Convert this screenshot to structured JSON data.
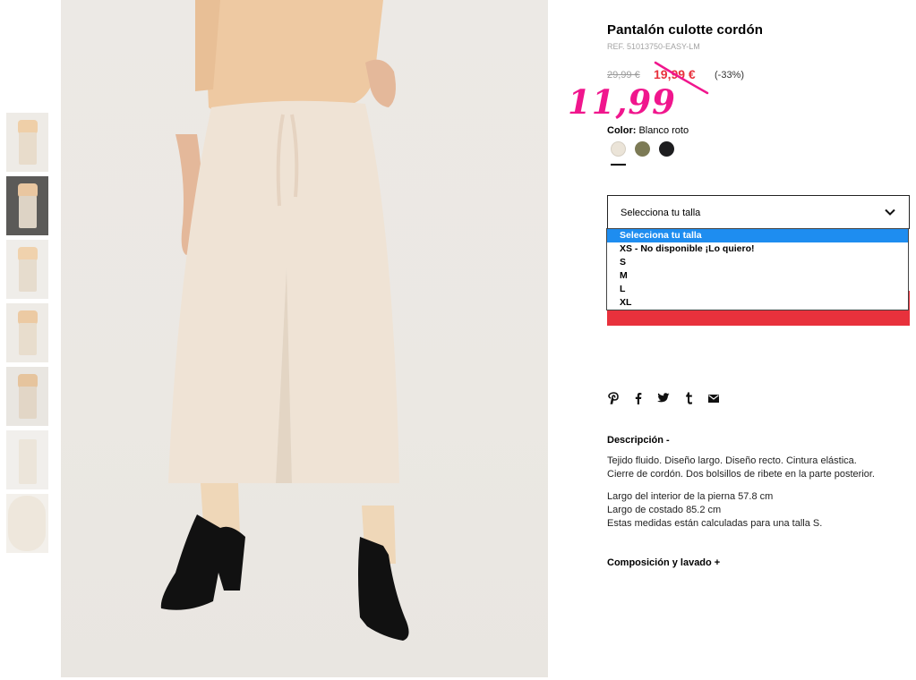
{
  "product": {
    "title": "Pantalón culotte cordón",
    "ref": "REF. 51013750-EASY-LM",
    "old_price": "29,99 €",
    "sale_price": "19,99 €",
    "discount": "(-33%)",
    "handwritten_price": "11,99"
  },
  "color": {
    "label": "Color:",
    "value": " Blanco roto",
    "swatches": [
      {
        "name": "Blanco roto",
        "hex": "#ebe4d8"
      },
      {
        "name": "Caqui",
        "hex": "#7c7a55"
      },
      {
        "name": "Negro",
        "hex": "#1d1d1f"
      }
    ]
  },
  "size": {
    "select_label": "Selecciona tu talla",
    "options": [
      "Selecciona tu talla",
      "XS - No disponible ¡Lo quiero!",
      "S",
      "M",
      "L",
      "XL"
    ]
  },
  "share_icons": [
    "pinterest-icon",
    "facebook-icon",
    "twitter-icon",
    "tumblr-icon",
    "email-icon"
  ],
  "description": {
    "title": "Descripción -",
    "p1_line1": "Tejido fluido. Diseño largo. Diseño recto. Cintura elástica.",
    "p1_line2": "Cierre de cordón. Dos bolsillos de ribete en la parte posterior.",
    "p2_line1": "Largo del interior de la pierna 57.8 cm",
    "p2_line2": "Largo de costado 85.2 cm",
    "p2_line3": "Estas medidas están calculadas para una talla S."
  },
  "composition": {
    "title": "Composición y lavado +"
  },
  "colors": {
    "accent_red": "#e8313c",
    "handwritten_pink": "#f0168d",
    "dropdown_highlight": "#1e8df0"
  }
}
